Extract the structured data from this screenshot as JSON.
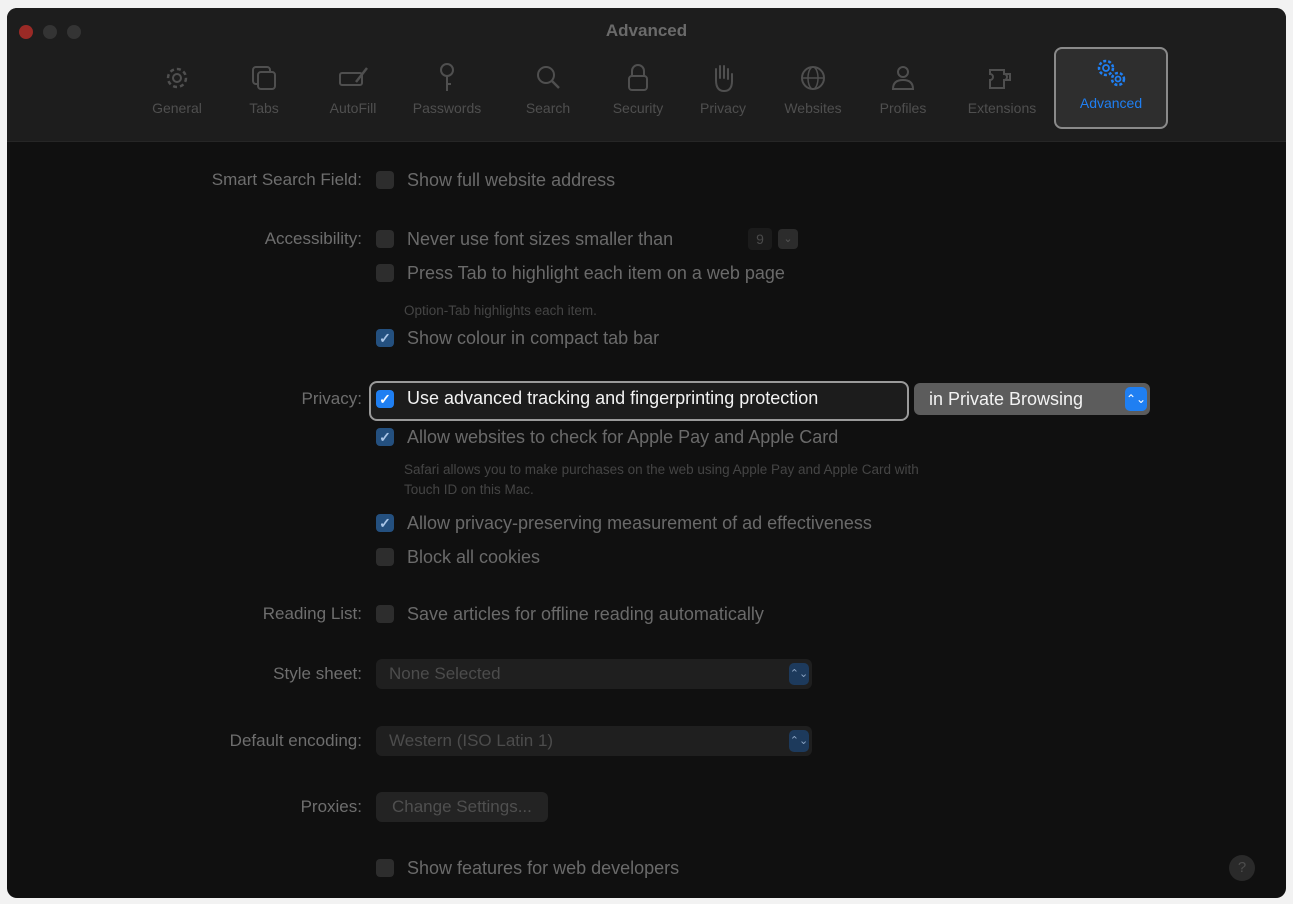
{
  "window": {
    "title": "Advanced"
  },
  "toolbar": {
    "items": [
      {
        "label": "General",
        "icon": "gear-icon"
      },
      {
        "label": "Tabs",
        "icon": "tabs-icon"
      },
      {
        "label": "AutoFill",
        "icon": "pencil-form-icon"
      },
      {
        "label": "Passwords",
        "icon": "key-icon"
      },
      {
        "label": "Search",
        "icon": "magnifier-icon"
      },
      {
        "label": "Security",
        "icon": "lock-icon"
      },
      {
        "label": "Privacy",
        "icon": "hand-icon"
      },
      {
        "label": "Websites",
        "icon": "globe-icon"
      },
      {
        "label": "Profiles",
        "icon": "person-icon"
      },
      {
        "label": "Extensions",
        "icon": "puzzle-icon"
      },
      {
        "label": "Advanced",
        "icon": "gears-icon",
        "selected": true
      }
    ]
  },
  "settings": {
    "smart_search": {
      "label": "Smart Search Field:",
      "option": "Show full website address",
      "checked": false
    },
    "accessibility": {
      "label": "Accessibility:",
      "font_size_option": "Never use font sizes smaller than",
      "font_size_value": "9",
      "tab_option": "Press Tab to highlight each item on a web page",
      "tab_note": "Option-Tab highlights each item.",
      "colour_option": "Show colour in compact tab bar",
      "colour_checked": true
    },
    "privacy": {
      "label": "Privacy:",
      "tracking_option": "Use advanced tracking and fingerprinting protection",
      "tracking_checked": true,
      "tracking_scope": "in Private Browsing",
      "applepay_option": "Allow websites to check for Apple Pay and Apple Card",
      "applepay_checked": true,
      "applepay_note_line1": "Safari allows you to make purchases on the web using Apple Pay and Apple Card with",
      "applepay_note_line2": "Touch ID on this Mac.",
      "ad_option": "Allow privacy-preserving measurement of ad effectiveness",
      "ad_checked": true,
      "cookies_option": "Block all cookies",
      "cookies_checked": false
    },
    "reading_list": {
      "label": "Reading List:",
      "option": "Save articles for offline reading automatically"
    },
    "style_sheet": {
      "label": "Style sheet:",
      "value": "None Selected"
    },
    "default_encoding": {
      "label": "Default encoding:",
      "value": "Western (ISO Latin 1)"
    },
    "proxies": {
      "label": "Proxies:",
      "button": "Change Settings..."
    },
    "developer": {
      "option": "Show features for web developers"
    }
  },
  "help": "?",
  "colors": {
    "accent": "#1f7ff2",
    "background": "#101010"
  }
}
